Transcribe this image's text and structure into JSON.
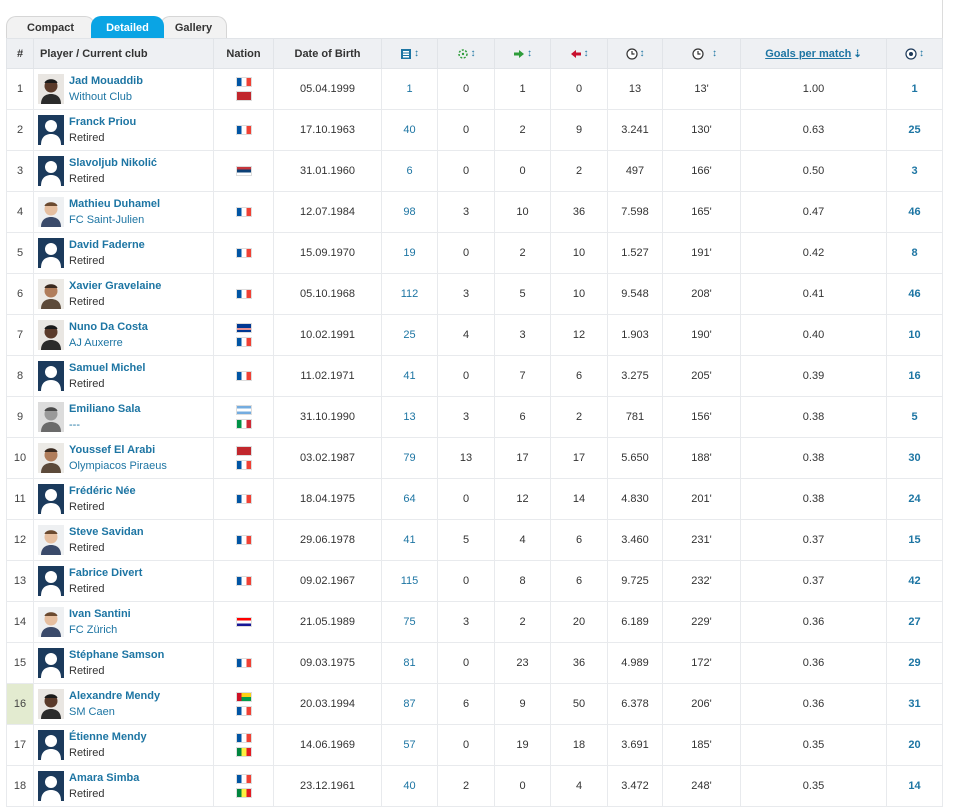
{
  "tabs": [
    {
      "label": "Compact",
      "active": false
    },
    {
      "label": "Detailed",
      "active": true
    },
    {
      "label": "Gallery",
      "active": false
    }
  ],
  "columns": {
    "rank": "#",
    "player": "Player / Current club",
    "nation": "Nation",
    "dob": "Date of Birth",
    "goals_per_match": "Goals per match"
  },
  "column_icons": [
    "appearances-icon",
    "penalty-goals-icon",
    "assists-icon",
    "substituted-off-icon",
    "minutes-played-icon",
    "minutes-per-goal-icon",
    "goals-icon"
  ],
  "colors": {
    "accent": "#0aa4e4",
    "link": "#1d75a3",
    "header_bg": "#eef0f3",
    "highlight_rank": "#e3ebd0"
  },
  "rows": [
    {
      "rank": "1",
      "name": "Jad Mouaddib",
      "club": "Without Club",
      "club_link": true,
      "photo": "dark",
      "nations": [
        "fr",
        "ma"
      ],
      "dob": "05.04.1999",
      "apps": "1",
      "pen": "0",
      "ast": "1",
      "subs": "0",
      "mins": "13",
      "mpg": "13'",
      "gpm": "1.00",
      "goals": "1"
    },
    {
      "rank": "2",
      "name": "Franck Priou",
      "club": "Retired",
      "club_link": false,
      "photo": "silhouette",
      "nations": [
        "fr"
      ],
      "dob": "17.10.1963",
      "apps": "40",
      "pen": "0",
      "ast": "2",
      "subs": "9",
      "mins": "3.241",
      "mpg": "130'",
      "gpm": "0.63",
      "goals": "25"
    },
    {
      "rank": "3",
      "name": "Slavoljub Nikolić",
      "club": "Retired",
      "club_link": false,
      "photo": "silhouette",
      "nations": [
        "rs"
      ],
      "dob": "31.01.1960",
      "apps": "6",
      "pen": "0",
      "ast": "0",
      "subs": "2",
      "mins": "497",
      "mpg": "166'",
      "gpm": "0.50",
      "goals": "3"
    },
    {
      "rank": "4",
      "name": "Mathieu Duhamel",
      "club": "FC Saint-Julien",
      "club_link": true,
      "photo": "light",
      "nations": [
        "fr"
      ],
      "dob": "12.07.1984",
      "apps": "98",
      "pen": "3",
      "ast": "10",
      "subs": "36",
      "mins": "7.598",
      "mpg": "165'",
      "gpm": "0.47",
      "goals": "46"
    },
    {
      "rank": "5",
      "name": "David Faderne",
      "club": "Retired",
      "club_link": false,
      "photo": "silhouette",
      "nations": [
        "fr"
      ],
      "dob": "15.09.1970",
      "apps": "19",
      "pen": "0",
      "ast": "2",
      "subs": "10",
      "mins": "1.527",
      "mpg": "191'",
      "gpm": "0.42",
      "goals": "8"
    },
    {
      "rank": "6",
      "name": "Xavier Gravelaine",
      "club": "Retired",
      "club_link": false,
      "photo": "mid",
      "nations": [
        "fr"
      ],
      "dob": "05.10.1968",
      "apps": "112",
      "pen": "3",
      "ast": "5",
      "subs": "10",
      "mins": "9.548",
      "mpg": "208'",
      "gpm": "0.41",
      "goals": "46"
    },
    {
      "rank": "7",
      "name": "Nuno Da Costa",
      "club": "AJ Auxerre",
      "club_link": true,
      "photo": "dark",
      "nations": [
        "cv",
        "fr"
      ],
      "dob": "10.02.1991",
      "apps": "25",
      "pen": "4",
      "ast": "3",
      "subs": "12",
      "mins": "1.903",
      "mpg": "190'",
      "gpm": "0.40",
      "goals": "10"
    },
    {
      "rank": "8",
      "name": "Samuel Michel",
      "club": "Retired",
      "club_link": false,
      "photo": "silhouette",
      "nations": [
        "fr"
      ],
      "dob": "11.02.1971",
      "apps": "41",
      "pen": "0",
      "ast": "7",
      "subs": "6",
      "mins": "3.275",
      "mpg": "205'",
      "gpm": "0.39",
      "goals": "16"
    },
    {
      "rank": "9",
      "name": "Emiliano Sala",
      "club": "---",
      "club_link": true,
      "photo": "grey",
      "nations": [
        "ar",
        "it"
      ],
      "dob": "31.10.1990",
      "apps": "13",
      "pen": "3",
      "ast": "6",
      "subs": "2",
      "mins": "781",
      "mpg": "156'",
      "gpm": "0.38",
      "goals": "5"
    },
    {
      "rank": "10",
      "name": "Youssef El Arabi",
      "club": "Olympiacos Piraeus",
      "club_link": true,
      "photo": "mid",
      "nations": [
        "ma",
        "fr"
      ],
      "dob": "03.02.1987",
      "apps": "79",
      "pen": "13",
      "ast": "17",
      "subs": "17",
      "mins": "5.650",
      "mpg": "188'",
      "gpm": "0.38",
      "goals": "30"
    },
    {
      "rank": "11",
      "name": "Frédéric Née",
      "club": "Retired",
      "club_link": false,
      "photo": "silhouette",
      "nations": [
        "fr"
      ],
      "dob": "18.04.1975",
      "apps": "64",
      "pen": "0",
      "ast": "12",
      "subs": "14",
      "mins": "4.830",
      "mpg": "201'",
      "gpm": "0.38",
      "goals": "24"
    },
    {
      "rank": "12",
      "name": "Steve Savidan",
      "club": "Retired",
      "club_link": false,
      "photo": "light",
      "nations": [
        "fr"
      ],
      "dob": "29.06.1978",
      "apps": "41",
      "pen": "5",
      "ast": "4",
      "subs": "6",
      "mins": "3.460",
      "mpg": "231'",
      "gpm": "0.37",
      "goals": "15"
    },
    {
      "rank": "13",
      "name": "Fabrice Divert",
      "club": "Retired",
      "club_link": false,
      "photo": "silhouette",
      "nations": [
        "fr"
      ],
      "dob": "09.02.1967",
      "apps": "115",
      "pen": "0",
      "ast": "8",
      "subs": "6",
      "mins": "9.725",
      "mpg": "232'",
      "gpm": "0.37",
      "goals": "42"
    },
    {
      "rank": "14",
      "name": "Ivan Santini",
      "club": "FC Zürich",
      "club_link": true,
      "photo": "light",
      "nations": [
        "hr"
      ],
      "dob": "21.05.1989",
      "apps": "75",
      "pen": "3",
      "ast": "2",
      "subs": "20",
      "mins": "6.189",
      "mpg": "229'",
      "gpm": "0.36",
      "goals": "27"
    },
    {
      "rank": "15",
      "name": "Stéphane Samson",
      "club": "Retired",
      "club_link": false,
      "photo": "silhouette",
      "nations": [
        "fr"
      ],
      "dob": "09.03.1975",
      "apps": "81",
      "pen": "0",
      "ast": "23",
      "subs": "36",
      "mins": "4.989",
      "mpg": "172'",
      "gpm": "0.36",
      "goals": "29"
    },
    {
      "rank": "16",
      "name": "Alexandre Mendy",
      "club": "SM Caen",
      "club_link": true,
      "photo": "dark",
      "nations": [
        "gw",
        "fr"
      ],
      "dob": "20.03.1994",
      "apps": "87",
      "pen": "6",
      "ast": "9",
      "subs": "50",
      "mins": "6.378",
      "mpg": "206'",
      "gpm": "0.36",
      "goals": "31",
      "highlight": true
    },
    {
      "rank": "17",
      "name": "Étienne Mendy",
      "club": "Retired",
      "club_link": false,
      "photo": "silhouette",
      "nations": [
        "fr",
        "sn"
      ],
      "dob": "14.06.1969",
      "apps": "57",
      "pen": "0",
      "ast": "19",
      "subs": "18",
      "mins": "3.691",
      "mpg": "185'",
      "gpm": "0.35",
      "goals": "20"
    },
    {
      "rank": "18",
      "name": "Amara Simba",
      "club": "Retired",
      "club_link": false,
      "photo": "silhouette",
      "nations": [
        "fr",
        "sn"
      ],
      "dob": "23.12.1961",
      "apps": "40",
      "pen": "2",
      "ast": "0",
      "subs": "4",
      "mins": "3.472",
      "mpg": "248'",
      "gpm": "0.35",
      "goals": "14"
    }
  ]
}
